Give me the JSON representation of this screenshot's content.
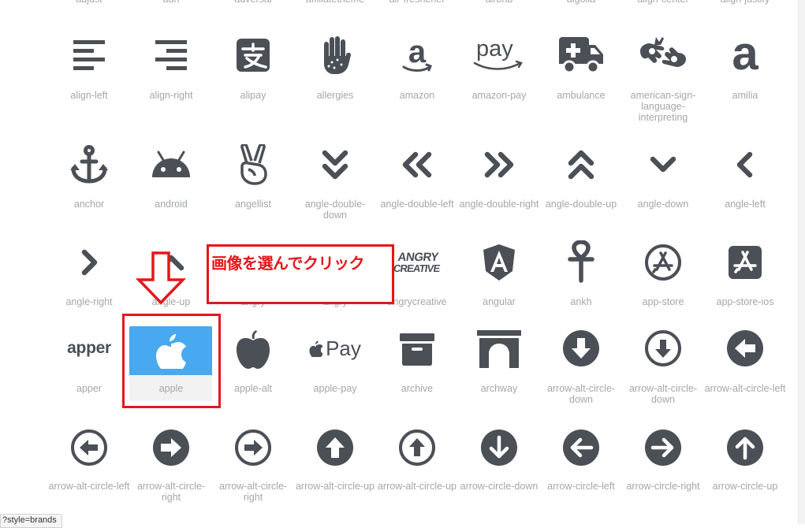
{
  "top_row_labels": [
    "adjust",
    "adn",
    "adversal",
    "affiliatetheme",
    "air-freshener",
    "airbnb",
    "algolia",
    "align-center",
    "align-justify"
  ],
  "row1": [
    "align-left",
    "align-right",
    "alipay",
    "allergies",
    "amazon",
    "amazon-pay",
    "ambulance",
    "american-sign-language-interpreting",
    "amilia"
  ],
  "row2": [
    "anchor",
    "android",
    "angellist",
    "angle-double-down",
    "angle-double-left",
    "angle-double-right",
    "angle-double-up",
    "angle-down",
    "angle-left"
  ],
  "row3": [
    "angle-right",
    "angle-up",
    "angry",
    "angry",
    "angrycreative",
    "angular",
    "ankh",
    "app-store",
    "app-store-ios"
  ],
  "row4": [
    "apper",
    "apple",
    "apple-alt",
    "apple-pay",
    "archive",
    "archway",
    "arrow-alt-circle-down",
    "arrow-alt-circle-down",
    "arrow-alt-circle-left"
  ],
  "row5": [
    "arrow-alt-circle-left",
    "arrow-alt-circle-right",
    "arrow-alt-circle-right",
    "arrow-alt-circle-up",
    "arrow-alt-circle-up",
    "arrow-circle-down",
    "arrow-circle-left",
    "arrow-circle-right",
    "arrow-circle-up"
  ],
  "wordmarks": {
    "amazon_pay": "pay",
    "amilia": "a",
    "angry_line1": "ANGRY",
    "angry_line2": "CREATIVE",
    "apper": "apper",
    "apple_pay": "Pay"
  },
  "annotation": "画像を選んでクリック",
  "status_bar": "?style=brands",
  "colors": {
    "icon": "#4b4f56",
    "label": "#a3a7ab",
    "selected": "#48a8f0",
    "annotation": "#e5161b"
  }
}
